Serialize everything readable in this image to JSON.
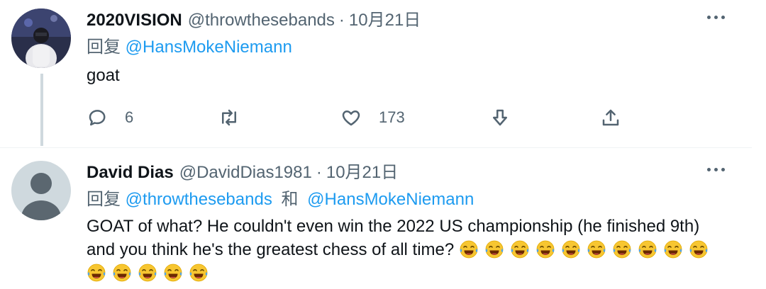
{
  "tweets": [
    {
      "name": "2020VISION",
      "handle": "@throwthesebands",
      "separator": "·",
      "date": "10月21日",
      "reply_label": "回复",
      "reply_mentions": [
        "@HansMokeNiemann"
      ],
      "text": "goat",
      "actions": {
        "reply_count": "6",
        "like_count": "173"
      },
      "icons": [
        "reply-icon",
        "retweet-icon",
        "like-icon",
        "downvote-icon",
        "share-icon",
        "more-icon"
      ]
    },
    {
      "name": "David Dias",
      "handle": "@DavidDias1981",
      "separator": "·",
      "date": "10月21日",
      "reply_label": "回复",
      "reply_mentions": [
        "@throwthesebands",
        "@HansMokeNiemann"
      ],
      "reply_conjunction": "和",
      "text": "GOAT of what? He couldn't even win the 2022 US championship (he finished 9th) and you think he's the greatest chess of all time?",
      "emoji_name": "face-with-tears-of-joy",
      "emoji_count": 15
    }
  ],
  "colors": {
    "text_primary": "#0f1419",
    "text_secondary": "#536471",
    "accent_link": "#1d9bf0",
    "thread_line": "#cfd9de",
    "emoji_face": "#f7c631"
  }
}
